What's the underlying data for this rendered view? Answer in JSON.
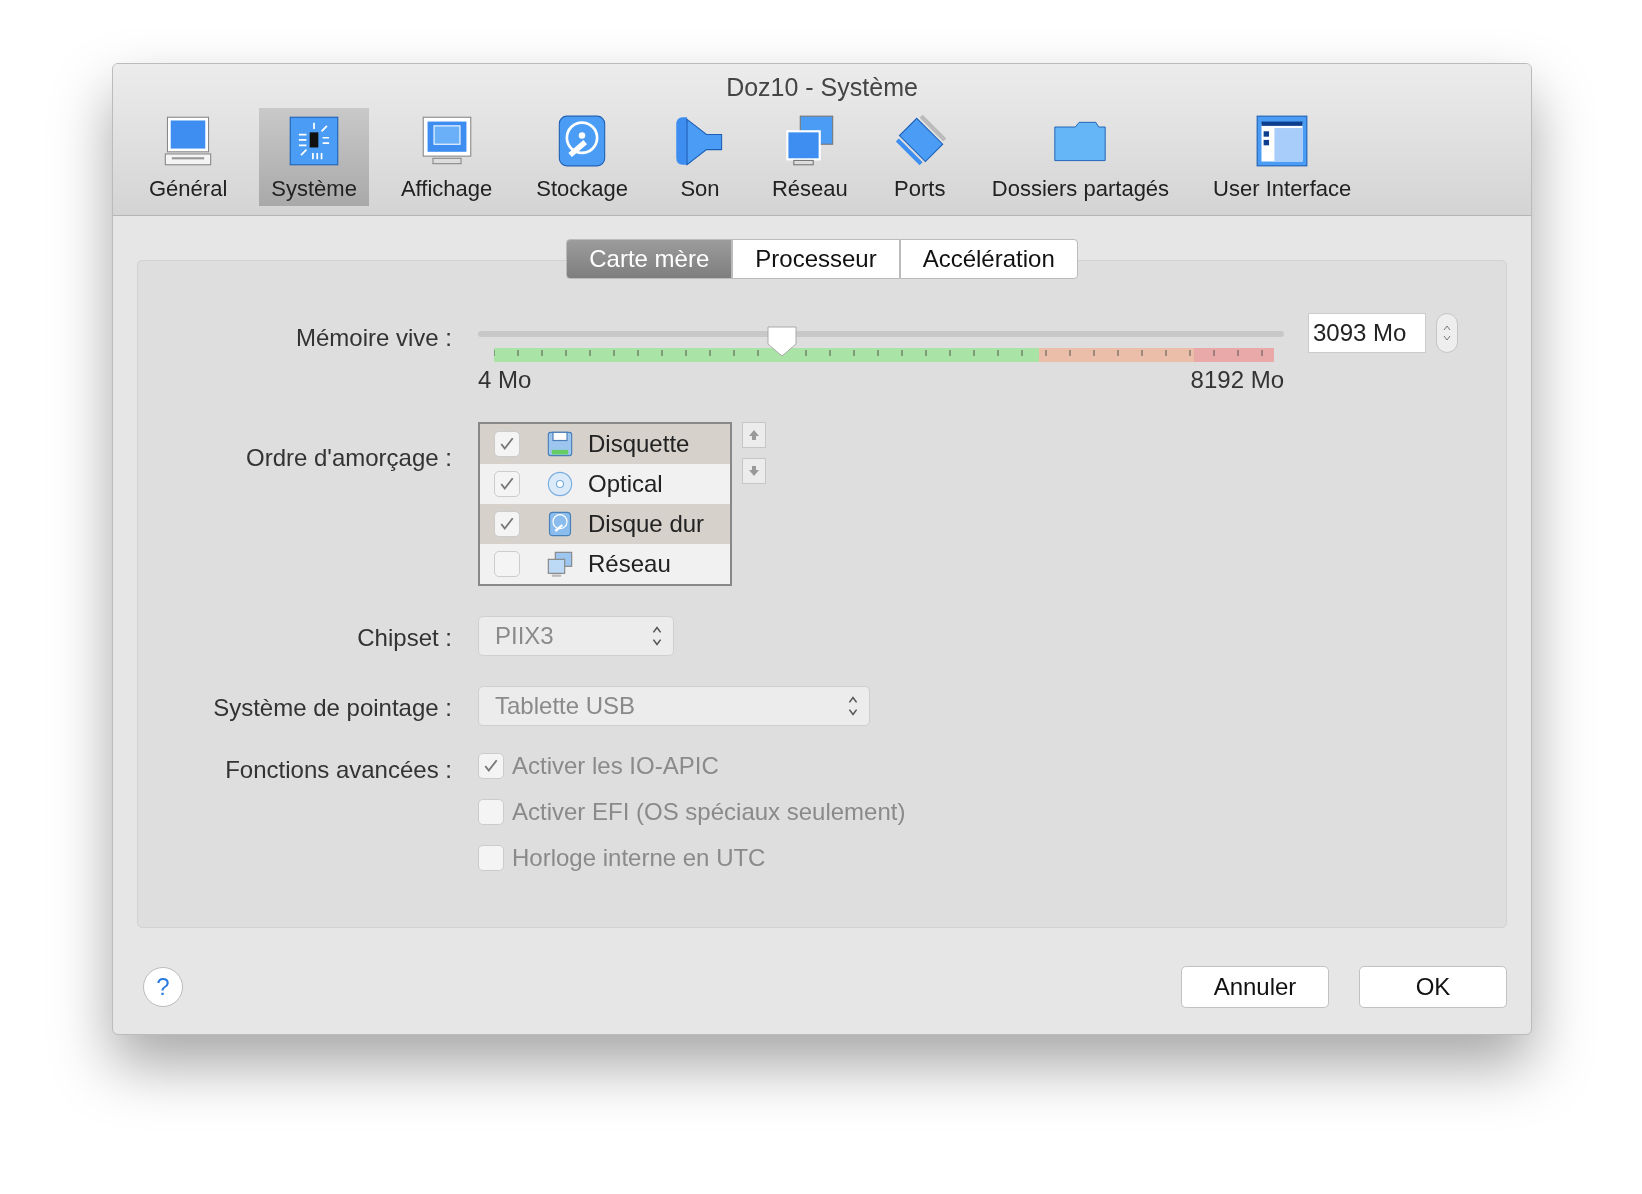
{
  "window": {
    "title": "Doz10 - Système"
  },
  "toolbar": [
    {
      "label": "Général",
      "selected": false
    },
    {
      "label": "Système",
      "selected": true
    },
    {
      "label": "Affichage",
      "selected": false
    },
    {
      "label": "Stockage",
      "selected": false
    },
    {
      "label": "Son",
      "selected": false
    },
    {
      "label": "Réseau",
      "selected": false
    },
    {
      "label": "Ports",
      "selected": false
    },
    {
      "label": "Dossiers partagés",
      "selected": false
    },
    {
      "label": "User Interface",
      "selected": false
    }
  ],
  "tabs": [
    {
      "label": "Carte mère",
      "selected": true
    },
    {
      "label": "Processeur",
      "selected": false
    },
    {
      "label": "Accélération",
      "selected": false
    }
  ],
  "memory": {
    "label": "Mémoire vive :",
    "level": 0.377,
    "value": "3093 Mo",
    "min_label": "4 Mo",
    "max_label": "8192 Mo"
  },
  "boot_order": {
    "label": "Ordre d'amorçage :",
    "items": [
      {
        "label": "Disquette",
        "checked": true
      },
      {
        "label": "Optical",
        "checked": true
      },
      {
        "label": "Disque dur",
        "checked": true
      },
      {
        "label": "Réseau",
        "checked": false
      }
    ]
  },
  "chipset": {
    "label": "Chipset :",
    "value": "PIIX3",
    "disabled": true
  },
  "pointing": {
    "label": "Système de pointage :",
    "value": "Tablette USB",
    "disabled": true
  },
  "advanced": {
    "label": "Fonctions avancées :",
    "options": [
      {
        "label": "Activer les IO-APIC",
        "checked": true,
        "disabled": true
      },
      {
        "label": "Activer EFI (OS spéciaux seulement)",
        "checked": false,
        "disabled": true
      },
      {
        "label": "Horloge interne en UTC",
        "checked": false,
        "disabled": true
      }
    ]
  },
  "buttons": {
    "help": "?",
    "cancel": "Annuler",
    "ok": "OK"
  }
}
